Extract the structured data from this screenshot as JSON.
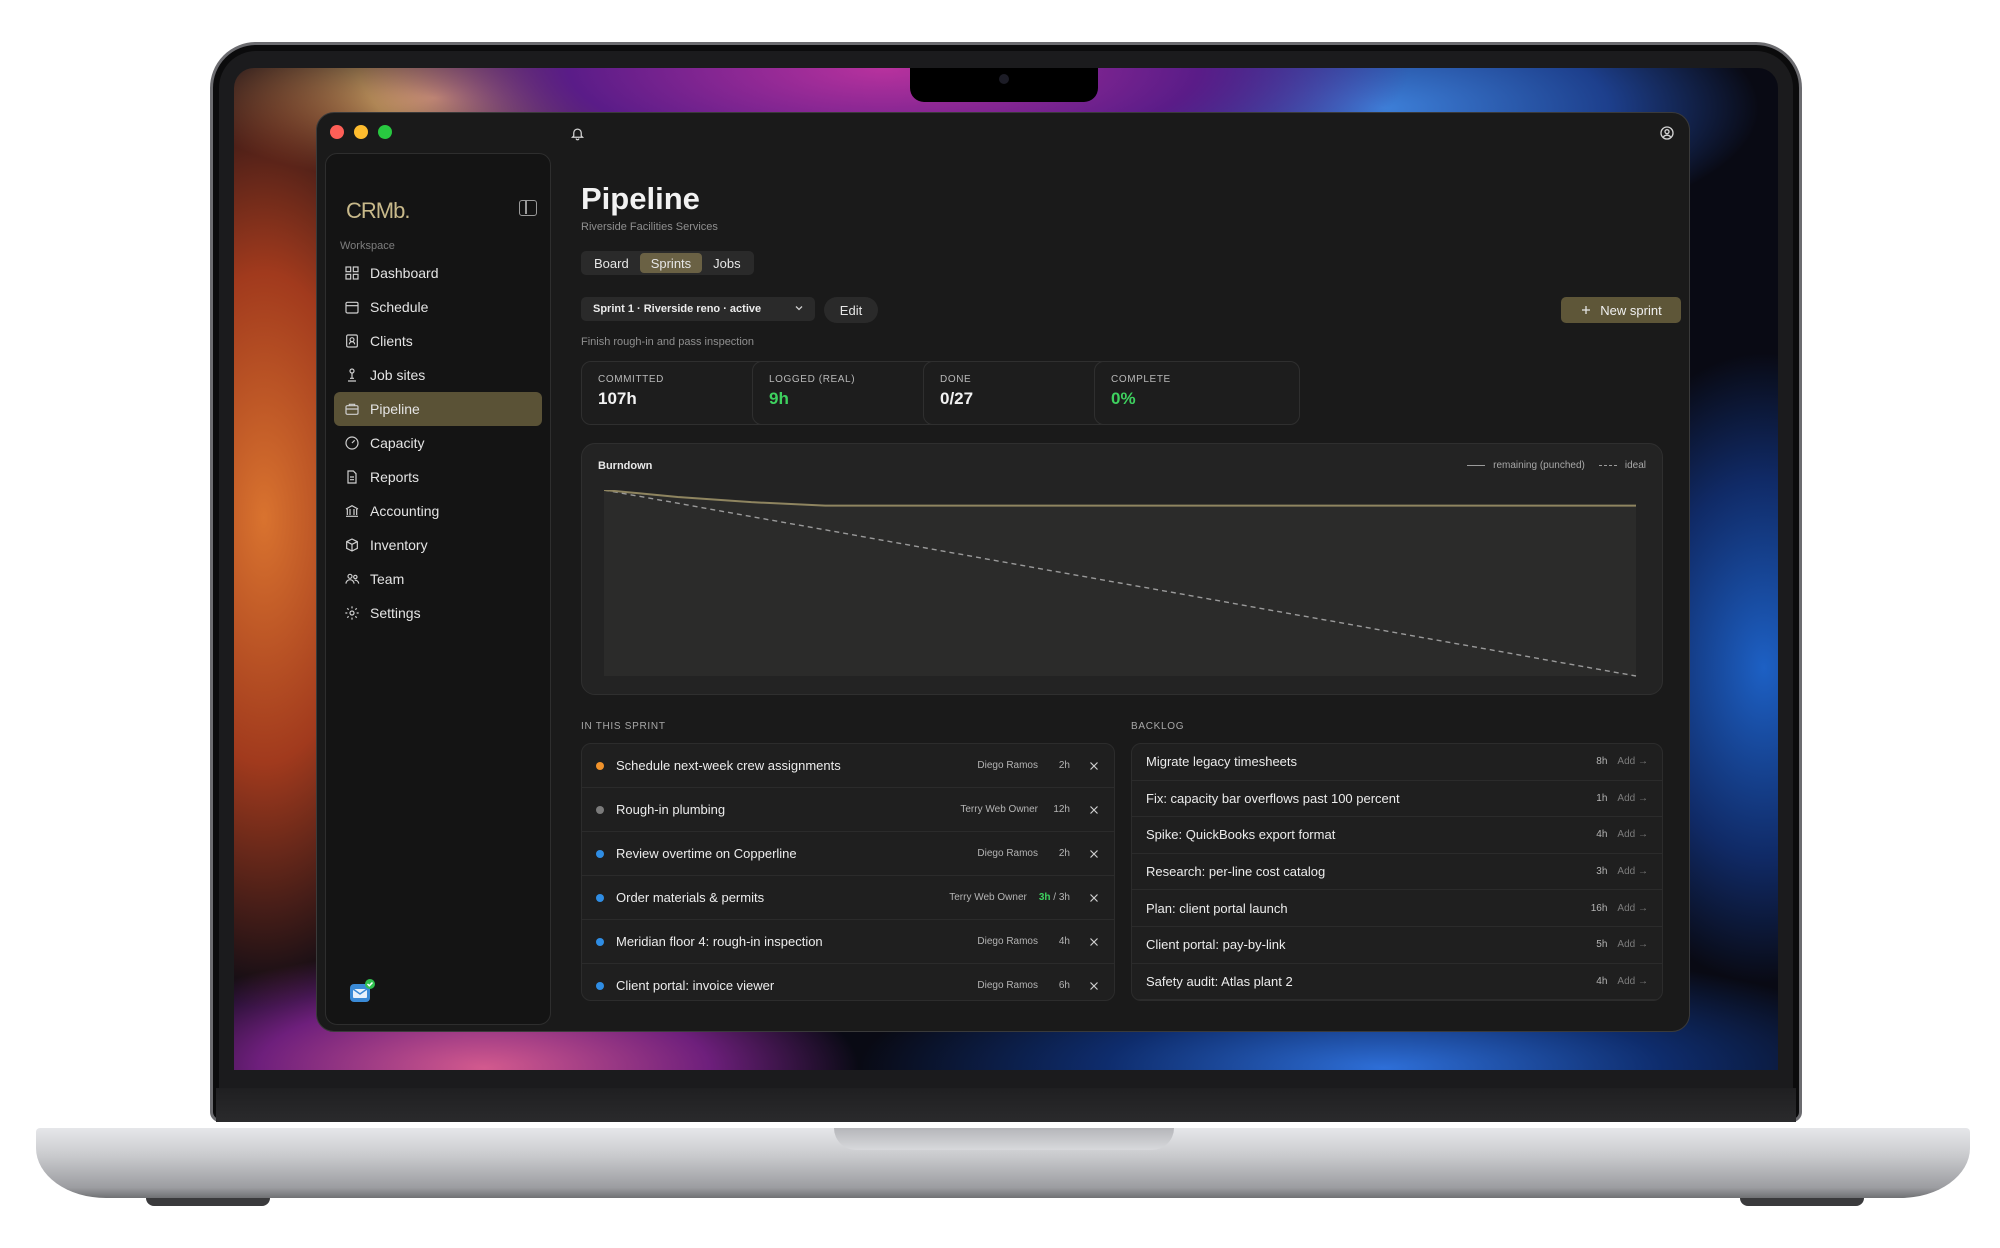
{
  "app": {
    "logo": "CRMb.",
    "workspace_label": "Workspace"
  },
  "sidebar": {
    "items": [
      {
        "label": "Dashboard",
        "icon": "grid-icon",
        "active": false
      },
      {
        "label": "Schedule",
        "icon": "calendar-icon",
        "active": false
      },
      {
        "label": "Clients",
        "icon": "contact-icon",
        "active": false
      },
      {
        "label": "Job sites",
        "icon": "pin-icon",
        "active": false
      },
      {
        "label": "Pipeline",
        "icon": "briefcase-icon",
        "active": true
      },
      {
        "label": "Capacity",
        "icon": "gauge-icon",
        "active": false
      },
      {
        "label": "Reports",
        "icon": "document-icon",
        "active": false
      },
      {
        "label": "Accounting",
        "icon": "bank-icon",
        "active": false
      },
      {
        "label": "Inventory",
        "icon": "box-icon",
        "active": false
      },
      {
        "label": "Team",
        "icon": "users-icon",
        "active": false
      },
      {
        "label": "Settings",
        "icon": "gear-icon",
        "active": false
      }
    ]
  },
  "page": {
    "title": "Pipeline",
    "subtitle": "Riverside Facilities Services"
  },
  "tabs": [
    {
      "label": "Board",
      "active": false
    },
    {
      "label": "Sprints",
      "active": true
    },
    {
      "label": "Jobs",
      "active": false
    }
  ],
  "toolbar": {
    "sprint_selected": "Sprint 1 · Riverside reno · active",
    "edit_label": "Edit",
    "new_sprint_label": "New sprint"
  },
  "sprint_goal": "Finish rough-in and pass inspection",
  "stats": [
    {
      "label": "COMMITTED",
      "value": "107h",
      "highlight": false
    },
    {
      "label": "LOGGED (REAL)",
      "value": "9h",
      "highlight": true
    },
    {
      "label": "DONE",
      "value": "0/27",
      "highlight": false
    },
    {
      "label": "COMPLETE",
      "value": "0%",
      "highlight": true
    }
  ],
  "burndown": {
    "title": "Burndown",
    "legend_remaining": "remaining (punched)",
    "legend_ideal": "ideal"
  },
  "chart_data": {
    "type": "line",
    "title": "Burndown",
    "x": [
      0,
      1,
      2,
      3,
      4,
      5,
      6,
      7,
      8,
      9,
      10,
      11,
      12,
      13,
      14
    ],
    "series": [
      {
        "name": "remaining (punched)",
        "values": [
          107,
          103,
          100,
          98,
          98,
          98,
          98,
          98,
          98,
          98,
          98,
          98,
          98,
          98,
          98
        ]
      },
      {
        "name": "ideal",
        "values": [
          107,
          99.4,
          91.7,
          84.1,
          76.4,
          68.8,
          61.1,
          53.5,
          45.9,
          38.2,
          30.6,
          22.9,
          15.3,
          7.6,
          0
        ]
      }
    ],
    "ylim": [
      0,
      107
    ],
    "grid": false,
    "legend": "top-right",
    "colors": {
      "remaining": "#8f8560",
      "ideal": "#9a9a9a"
    }
  },
  "in_sprint": {
    "label": "IN THIS SPRINT",
    "items": [
      {
        "title": "Schedule next-week crew assignments",
        "owner": "Diego Ramos",
        "hours": "2h",
        "logged": "",
        "dot": "#f0922b"
      },
      {
        "title": "Rough-in plumbing",
        "owner": "Terry Web Owner",
        "hours": "12h",
        "logged": "",
        "dot": "#7a7a7a"
      },
      {
        "title": "Review overtime on Copperline",
        "owner": "Diego Ramos",
        "hours": "2h",
        "logged": "",
        "dot": "#2f8de4"
      },
      {
        "title": "Order materials & permits",
        "owner": "Terry Web Owner",
        "hours": " / 3h",
        "logged": "3h",
        "dot": "#2f8de4"
      },
      {
        "title": "Meridian floor 4: rough-in inspection",
        "owner": "Diego Ramos",
        "hours": "4h",
        "logged": "",
        "dot": "#2f8de4"
      },
      {
        "title": "Client portal: invoice viewer",
        "owner": "Diego Ramos",
        "hours": "6h",
        "logged": "",
        "dot": "#2f8de4"
      }
    ]
  },
  "backlog": {
    "label": "BACKLOG",
    "add_label": "Add →",
    "items": [
      {
        "title": "Migrate legacy timesheets",
        "hours": "8h"
      },
      {
        "title": "Fix: capacity bar overflows past 100 percent",
        "hours": "1h"
      },
      {
        "title": "Spike: QuickBooks export format",
        "hours": "4h"
      },
      {
        "title": "Research: per-line cost catalog",
        "hours": "3h"
      },
      {
        "title": "Plan: client portal launch",
        "hours": "16h"
      },
      {
        "title": "Client portal: pay-by-link",
        "hours": "5h"
      },
      {
        "title": "Safety audit: Atlas plant 2",
        "hours": "4h"
      }
    ]
  }
}
